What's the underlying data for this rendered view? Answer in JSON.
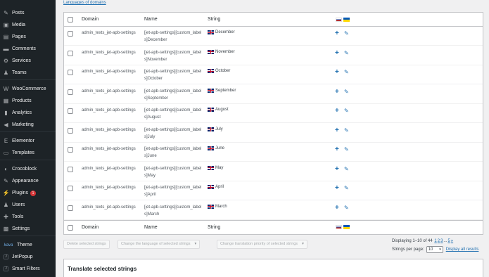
{
  "sidebar": {
    "items": [
      {
        "label": "Posts",
        "icon": "pin-icon",
        "glyph": "✎"
      },
      {
        "label": "Media",
        "icon": "media-icon",
        "glyph": "▣"
      },
      {
        "label": "Pages",
        "icon": "pages-icon",
        "glyph": "▤"
      },
      {
        "label": "Comments",
        "icon": "comments-icon",
        "glyph": "▬"
      },
      {
        "label": "Services",
        "icon": "services-icon",
        "glyph": "⚙"
      },
      {
        "label": "Teams",
        "icon": "teams-icon",
        "glyph": "♟"
      },
      {
        "label": "WooCommerce",
        "icon": "woocommerce-icon",
        "glyph": "W"
      },
      {
        "label": "Products",
        "icon": "products-icon",
        "glyph": "▦"
      },
      {
        "label": "Analytics",
        "icon": "analytics-icon",
        "glyph": "▮"
      },
      {
        "label": "Marketing",
        "icon": "marketing-icon",
        "glyph": "◀"
      },
      {
        "label": "Elementor",
        "icon": "elementor-icon",
        "glyph": "E"
      },
      {
        "label": "Templates",
        "icon": "templates-icon",
        "glyph": "▭"
      },
      {
        "label": "Crocoblock",
        "icon": "crocoblock-icon",
        "glyph": "◐"
      },
      {
        "label": "Appearance",
        "icon": "appearance-icon",
        "glyph": "✎"
      },
      {
        "label": "Plugins",
        "icon": "plugins-icon",
        "glyph": "⚡",
        "badge": "1"
      },
      {
        "label": "Users",
        "icon": "users-icon",
        "glyph": "♟"
      },
      {
        "label": "Tools",
        "icon": "tools-icon",
        "glyph": "✚"
      },
      {
        "label": "Settings",
        "icon": "settings-icon",
        "glyph": "▩"
      },
      {
        "label": "Theme",
        "icon": "theme-icon",
        "glyph": "kava"
      },
      {
        "label": "JetPopup",
        "icon": "jetpopup-icon",
        "glyph": "JET"
      },
      {
        "label": "Smart Filters",
        "icon": "smart-filters-icon",
        "glyph": "JET"
      }
    ]
  },
  "languages_link": "Languages of domains",
  "table": {
    "headers": {
      "domain": "Domain",
      "name": "Name",
      "string": "String"
    },
    "rows": [
      {
        "domain": "admin_texts_jet-apb-settings",
        "name": "[jet-apb-settings][custom_labels]December",
        "string": "December"
      },
      {
        "domain": "admin_texts_jet-apb-settings",
        "name": "[jet-apb-settings][custom_labels]November",
        "string": "November"
      },
      {
        "domain": "admin_texts_jet-apb-settings",
        "name": "[jet-apb-settings][custom_labels]October",
        "string": "October"
      },
      {
        "domain": "admin_texts_jet-apb-settings",
        "name": "[jet-apb-settings][custom_labels]September",
        "string": "September"
      },
      {
        "domain": "admin_texts_jet-apb-settings",
        "name": "[jet-apb-settings][custom_labels]August",
        "string": "August"
      },
      {
        "domain": "admin_texts_jet-apb-settings",
        "name": "[jet-apb-settings][custom_labels]July",
        "string": "July"
      },
      {
        "domain": "admin_texts_jet-apb-settings",
        "name": "[jet-apb-settings][custom_labels]June",
        "string": "June"
      },
      {
        "domain": "admin_texts_jet-apb-settings",
        "name": "[jet-apb-settings][custom_labels]May",
        "string": "May"
      },
      {
        "domain": "admin_texts_jet-apb-settings",
        "name": "[jet-apb-settings][custom_labels]April",
        "string": "April"
      },
      {
        "domain": "admin_texts_jet-apb-settings",
        "name": "[jet-apb-settings][custom_labels]March",
        "string": "March"
      }
    ]
  },
  "bulk": {
    "delete": "Delete selected strings",
    "change_language": "Change the language of selected strings",
    "change_priority": "Change translation priority of selected strings"
  },
  "pager": {
    "displaying": "Displaying 1–10 of 44",
    "pages": [
      "1",
      "2",
      "3",
      "...",
      "5",
      "»"
    ],
    "per_page_label": "Strings per page:",
    "per_page_value": "10",
    "display_all": "Display all results"
  },
  "translate": {
    "title": "Translate selected strings"
  },
  "colors": {
    "sidebar_bg": "#1d2327",
    "link": "#2271b1",
    "badge": "#d63638"
  }
}
